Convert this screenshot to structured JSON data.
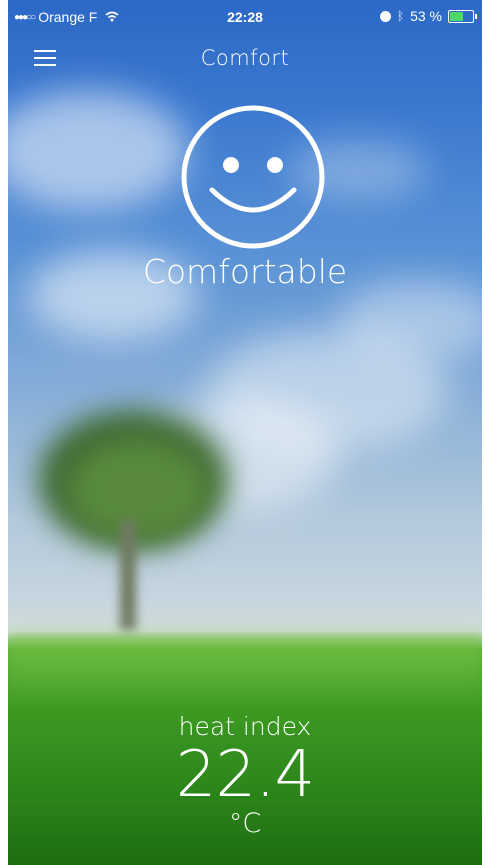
{
  "status_bar": {
    "carrier": "Orange F",
    "time": "22:28",
    "battery_percent": "53 %",
    "battery_level": 0.53,
    "icons": [
      "signal-dots-icon",
      "wifi-icon",
      "alarm-icon",
      "bluetooth-icon",
      "battery-icon"
    ]
  },
  "nav": {
    "title": "Comfort",
    "menu_icon": "hamburger-menu-icon"
  },
  "comfort": {
    "icon": "smiley-face-icon",
    "label": "Comfortable"
  },
  "heat_index": {
    "label": "heat index",
    "value": "22.4",
    "unit": "°C"
  },
  "colors": {
    "sky": "#3a78cf",
    "grass": "#3c9a22",
    "text": "#ffffff",
    "battery": "#4cd964"
  }
}
